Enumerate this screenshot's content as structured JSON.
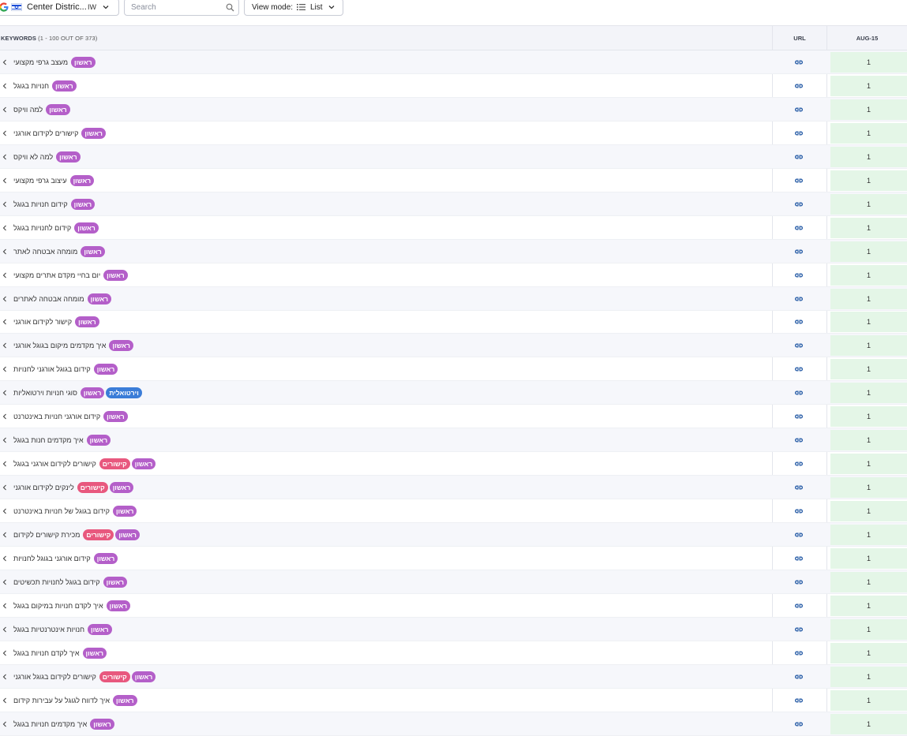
{
  "toolbar": {
    "location": "Center Distric...",
    "country_code": "IW",
    "search_placeholder": "Search",
    "view_mode_label": "View mode:",
    "view_mode_value": "List"
  },
  "header": {
    "keywords_label": "KEYWORDS",
    "keywords_range": "(1 - 100 OUT OF 373)",
    "url_label": "URL",
    "date_label": "AUG-15"
  },
  "colors": {
    "tag_purple": "#b45fc9",
    "tag_pink": "#e8587e",
    "tag_blue": "#3b7dd8",
    "rank_bg": "#e4f6e7"
  },
  "rows": [
    {
      "keyword": "מעצב גרפי מקצועי",
      "tags": [
        {
          "text": "ראשון",
          "color": "purple"
        }
      ],
      "rank": "1"
    },
    {
      "keyword": "חנויות בגוגל",
      "tags": [
        {
          "text": "ראשון",
          "color": "purple"
        }
      ],
      "rank": "1"
    },
    {
      "keyword": "למה וויקס",
      "tags": [
        {
          "text": "ראשון",
          "color": "purple"
        }
      ],
      "rank": "1"
    },
    {
      "keyword": "קישורים לקידום אורגני",
      "tags": [
        {
          "text": "ראשון",
          "color": "purple"
        }
      ],
      "rank": "1"
    },
    {
      "keyword": "למה לא וויקס",
      "tags": [
        {
          "text": "ראשון",
          "color": "purple"
        }
      ],
      "rank": "1"
    },
    {
      "keyword": "עיצוב גרפי מקצועי",
      "tags": [
        {
          "text": "ראשון",
          "color": "purple"
        }
      ],
      "rank": "1"
    },
    {
      "keyword": "קידום חנויות בגוגל",
      "tags": [
        {
          "text": "ראשון",
          "color": "purple"
        }
      ],
      "rank": "1"
    },
    {
      "keyword": "קידום לחנויות בגוגל",
      "tags": [
        {
          "text": "ראשון",
          "color": "purple"
        }
      ],
      "rank": "1"
    },
    {
      "keyword": "מומחה אבטחה לאתר",
      "tags": [
        {
          "text": "ראשון",
          "color": "purple"
        }
      ],
      "rank": "1"
    },
    {
      "keyword": "יום בחיי מקדם אתרים מקצועי",
      "tags": [
        {
          "text": "ראשון",
          "color": "purple"
        }
      ],
      "rank": "1"
    },
    {
      "keyword": "מומחה אבטחה לאתרים",
      "tags": [
        {
          "text": "ראשון",
          "color": "purple"
        }
      ],
      "rank": "1"
    },
    {
      "keyword": "קישור לקידום אורגני",
      "tags": [
        {
          "text": "ראשון",
          "color": "purple"
        }
      ],
      "rank": "1"
    },
    {
      "keyword": "איך מקדמים מיקום בגוגל אורגני",
      "tags": [
        {
          "text": "ראשון",
          "color": "purple"
        }
      ],
      "rank": "1"
    },
    {
      "keyword": "קידום בגוגל אורגני לחנויות",
      "tags": [
        {
          "text": "ראשון",
          "color": "purple"
        }
      ],
      "rank": "1"
    },
    {
      "keyword": "סוגי חנויות וירטואליות",
      "tags": [
        {
          "text": "ראשון",
          "color": "purple"
        },
        {
          "text": "וירטואלית",
          "color": "blue"
        }
      ],
      "rank": "1"
    },
    {
      "keyword": "קידום אורגני חנויות באינטרנט",
      "tags": [
        {
          "text": "ראשון",
          "color": "purple"
        }
      ],
      "rank": "1"
    },
    {
      "keyword": "איך מקדמים חנות בגוגל",
      "tags": [
        {
          "text": "ראשון",
          "color": "purple"
        }
      ],
      "rank": "1"
    },
    {
      "keyword": "קישורים לקידום אורגני בגוגל",
      "tags": [
        {
          "text": "קישורים",
          "color": "pink"
        },
        {
          "text": "ראשון",
          "color": "purple"
        }
      ],
      "rank": "1"
    },
    {
      "keyword": "לינקים לקידום אורגני",
      "tags": [
        {
          "text": "קישורים",
          "color": "pink"
        },
        {
          "text": "ראשון",
          "color": "purple"
        }
      ],
      "rank": "1"
    },
    {
      "keyword": "קידום בגוגל של חנויות באינטרנט",
      "tags": [
        {
          "text": "ראשון",
          "color": "purple"
        }
      ],
      "rank": "1"
    },
    {
      "keyword": "מכירת קישורים לקידום",
      "tags": [
        {
          "text": "קישורים",
          "color": "pink"
        },
        {
          "text": "ראשון",
          "color": "purple"
        }
      ],
      "rank": "1"
    },
    {
      "keyword": "קידום אורגני בגוגל לחנויות",
      "tags": [
        {
          "text": "ראשון",
          "color": "purple"
        }
      ],
      "rank": "1"
    },
    {
      "keyword": "קידום בגוגל לחנויות תכשיטים",
      "tags": [
        {
          "text": "ראשון",
          "color": "purple"
        }
      ],
      "rank": "1"
    },
    {
      "keyword": "איך לקדם חנויות במיקום בגוגל",
      "tags": [
        {
          "text": "ראשון",
          "color": "purple"
        }
      ],
      "rank": "1"
    },
    {
      "keyword": "חנויות אינטרנטיות בגוגל",
      "tags": [
        {
          "text": "ראשון",
          "color": "purple"
        }
      ],
      "rank": "1"
    },
    {
      "keyword": "איך לקדם חנויות בגוגל",
      "tags": [
        {
          "text": "ראשון",
          "color": "purple"
        }
      ],
      "rank": "1"
    },
    {
      "keyword": "קישורים לקידום בגוגל אורגני",
      "tags": [
        {
          "text": "קישורים",
          "color": "pink"
        },
        {
          "text": "ראשון",
          "color": "purple"
        }
      ],
      "rank": "1"
    },
    {
      "keyword": "איך לדווח לגוגל על עבירות קידום",
      "tags": [
        {
          "text": "ראשון",
          "color": "purple"
        }
      ],
      "rank": "1"
    },
    {
      "keyword": "איך מקדמים חנויות בגוגל",
      "tags": [
        {
          "text": "ראשון",
          "color": "purple"
        }
      ],
      "rank": "1"
    }
  ]
}
